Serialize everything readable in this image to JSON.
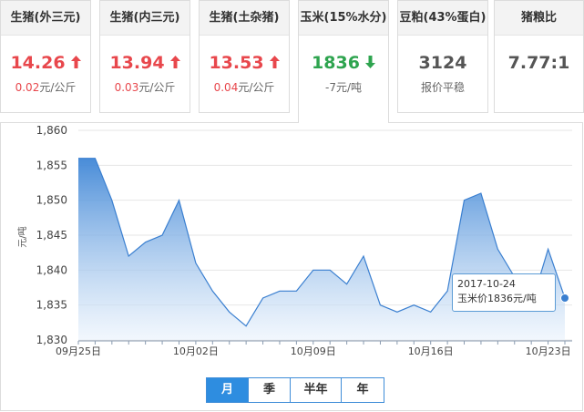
{
  "cards": [
    {
      "title": "生猪(外三元)",
      "value": "14.26",
      "change": "0.02",
      "unit": "元/公斤",
      "trend": "up"
    },
    {
      "title": "生猪(内三元)",
      "value": "13.94",
      "change": "0.03",
      "unit": "元/公斤",
      "trend": "up"
    },
    {
      "title": "生猪(土杂猪)",
      "value": "13.53",
      "change": "0.04",
      "unit": "元/公斤",
      "trend": "up"
    },
    {
      "title": "玉米(15%水分)",
      "value": "1836",
      "change": "-7",
      "unit": "元/吨",
      "trend": "down"
    },
    {
      "title": "豆粕(43%蛋白)",
      "value": "3124",
      "change": "报价平稳",
      "unit": "",
      "trend": "flat"
    },
    {
      "title": "猪粮比",
      "value": "7.77:1",
      "change": "",
      "unit": "",
      "trend": "none"
    }
  ],
  "colors": {
    "up": "#e8474c",
    "down": "#2ea44f",
    "line": "#3a7fd0",
    "fill_top": "#4a8fdc",
    "fill_bottom": "#eaf3fc"
  },
  "tooltip": {
    "date": "2017-10-24",
    "text": "玉米价1836元/吨"
  },
  "range_buttons": [
    "月",
    "季",
    "半年",
    "年"
  ],
  "chart_data": {
    "type": "area",
    "ylabel": "元/吨",
    "ylim": [
      1830,
      1860
    ],
    "yticks": [
      "1,830",
      "1,835",
      "1,840",
      "1,845",
      "1,850",
      "1,855",
      "1,860"
    ],
    "xtick_labels": [
      "09月25日",
      "10月02日",
      "10月09日",
      "10月16日",
      "10月23日"
    ],
    "xtick_index": [
      0,
      7,
      14,
      21,
      28
    ],
    "x": [
      "09-25",
      "09-26",
      "09-27",
      "09-28",
      "09-29",
      "09-30",
      "10-01",
      "10-02",
      "10-03",
      "10-04",
      "10-05",
      "10-06",
      "10-07",
      "10-08",
      "10-09",
      "10-10",
      "10-11",
      "10-12",
      "10-13",
      "10-14",
      "10-15",
      "10-16",
      "10-17",
      "10-18",
      "10-19",
      "10-20",
      "10-21",
      "10-22",
      "10-23",
      "10-24"
    ],
    "values": [
      1856,
      1856,
      1850,
      1842,
      1844,
      1845,
      1850,
      1841,
      1837,
      1834,
      1832,
      1836,
      1837,
      1837,
      1840,
      1840,
      1838,
      1842,
      1835,
      1834,
      1835,
      1834,
      1837,
      1850,
      1851,
      1843,
      1839,
      1835,
      1843,
      1836
    ],
    "grid": true,
    "legend": "none"
  }
}
